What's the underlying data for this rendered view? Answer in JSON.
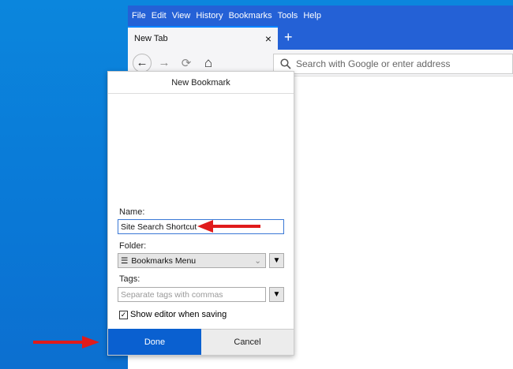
{
  "menu": [
    "File",
    "Edit",
    "View",
    "History",
    "Bookmarks",
    "Tools",
    "Help"
  ],
  "tab": {
    "title": "New Tab",
    "close": "×",
    "new": "+"
  },
  "nav": {
    "back": "←",
    "forward": "→",
    "reload": "⟳",
    "home": "⌂"
  },
  "url": {
    "placeholder": "Search with Google or enter address"
  },
  "dialog": {
    "title": "New Bookmark",
    "name_label": "Name:",
    "name_value": "Site Search Shortcut",
    "folder_label": "Folder:",
    "folder_value": "Bookmarks Menu",
    "tags_label": "Tags:",
    "tags_placeholder": "Separate tags with commas",
    "show_editor": "Show editor when saving",
    "show_editor_checked": true,
    "done": "Done",
    "cancel": "Cancel"
  },
  "colors": {
    "arrow": "#e01b1b",
    "accent": "#0a60d0"
  }
}
